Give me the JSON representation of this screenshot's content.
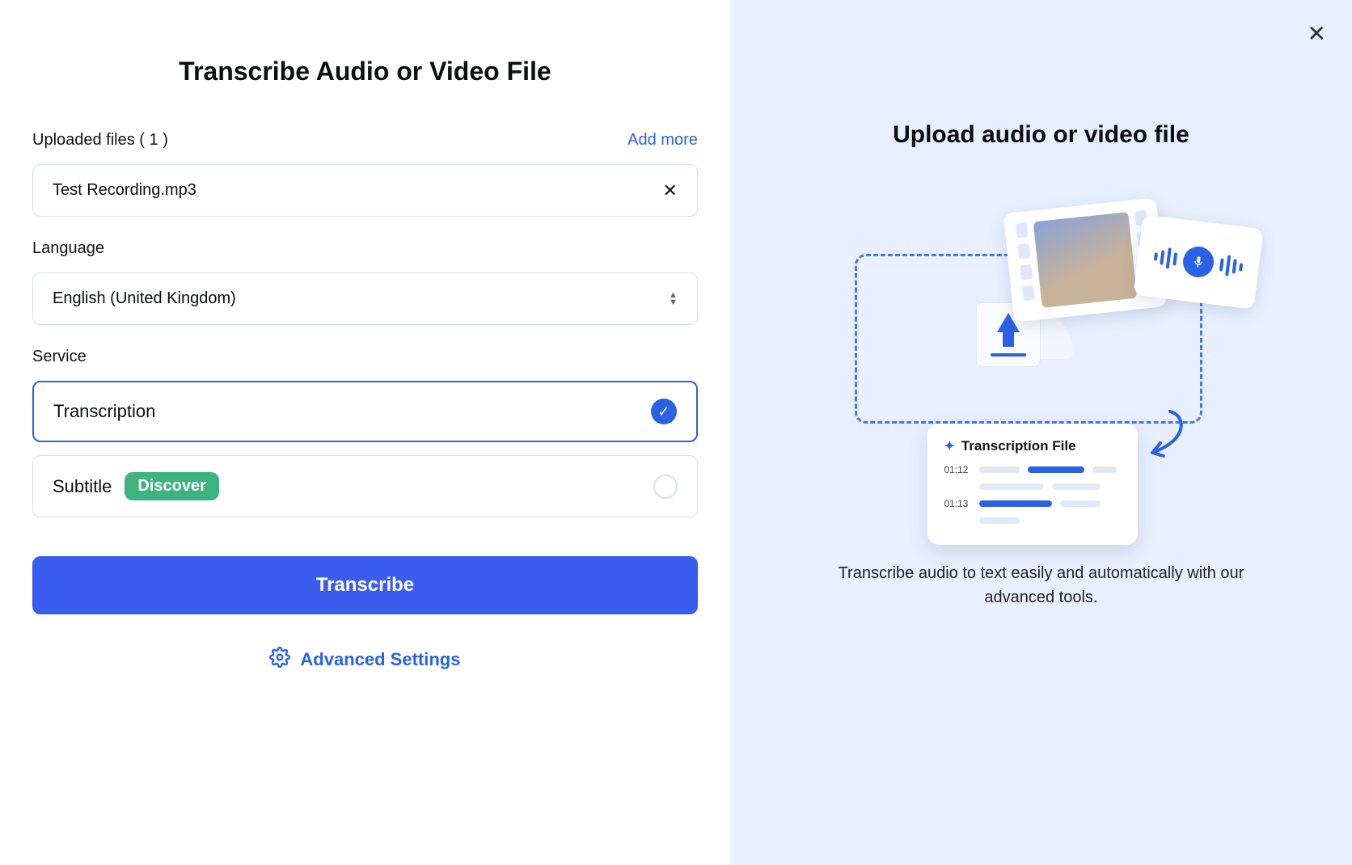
{
  "left": {
    "title": "Transcribe Audio or Video File",
    "uploaded_label": "Uploaded files ( 1 )",
    "add_more": "Add more",
    "file_name": "Test Recording.mp3",
    "language_label": "Language",
    "language_value": "English (United Kingdom)",
    "service_label": "Service",
    "service_options": {
      "transcription": "Transcription",
      "subtitle": "Subtitle",
      "discover_badge": "Discover"
    },
    "transcribe_button": "Transcribe",
    "advanced_settings": "Advanced Settings"
  },
  "right": {
    "title": "Upload audio or video file",
    "description": "Transcribe audio to text easily and automatically with our advanced tools.",
    "trans_card_title": "Transcription File",
    "time1": "01:12",
    "time2": "01:13"
  },
  "colors": {
    "primary": "#2a62e6",
    "button": "#3a5def",
    "green": "#3fb37f",
    "right_bg": "#e8efff"
  }
}
